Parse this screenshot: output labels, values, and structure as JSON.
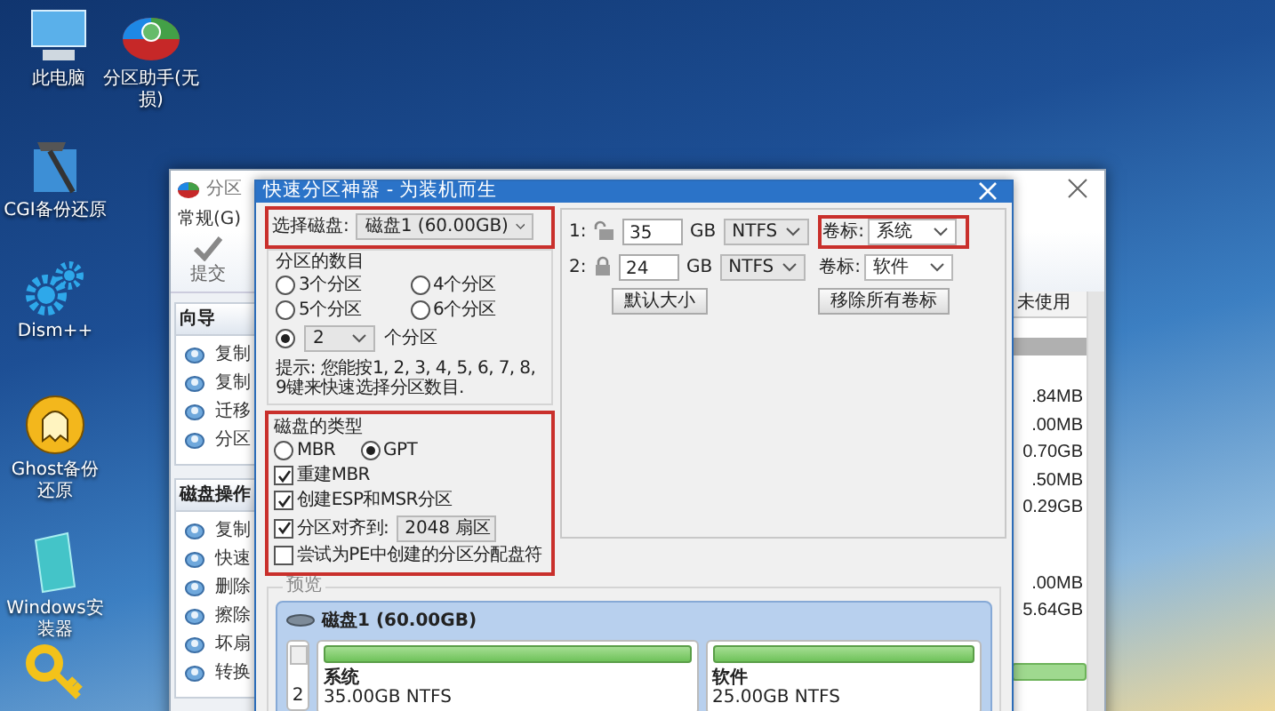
{
  "desktop_icons": [
    {
      "kind": "pc",
      "label": "此电脑"
    },
    {
      "kind": "partition",
      "label": "分区助手(无损)"
    },
    {
      "kind": "cgi",
      "label": "CGI备份还原"
    },
    {
      "kind": "dism",
      "label": "Dism++"
    },
    {
      "kind": "ghost",
      "label": "Ghost备份还原"
    },
    {
      "kind": "installer",
      "label": "Windows安装器"
    },
    {
      "kind": "key"
    }
  ],
  "background_window": {
    "title": "分区",
    "menu": [
      "常规(G)"
    ],
    "toolbar": [
      {
        "label": "提交"
      }
    ],
    "sections": [
      {
        "title": "向导",
        "items": [
          "复制",
          "复制",
          "迁移",
          "分区"
        ]
      },
      {
        "title": "磁盘操作",
        "items": [
          "复制",
          "快速",
          "删除",
          "擦除",
          "坏扇",
          "转换"
        ]
      }
    ],
    "table": {
      "header": "未使用",
      "groups": [
        [
          ".84MB",
          ".00MB",
          "0.70GB",
          ".50MB",
          "0.29GB"
        ],
        [
          ".00MB",
          "5.64GB"
        ]
      ]
    }
  },
  "dialog": {
    "title": "快速分区神器 - 为装机而生",
    "disk_select": {
      "label": "选择磁盘:",
      "value": "磁盘1 (60.00GB)",
      "highlighted": true
    },
    "partition_count": {
      "title": "分区的数目",
      "options": [
        {
          "label": "3个分区",
          "selected": false
        },
        {
          "label": "4个分区",
          "selected": false
        },
        {
          "label": "5个分区",
          "selected": false
        },
        {
          "label": "6个分区",
          "selected": false
        }
      ],
      "custom": {
        "selected": true,
        "value": "2",
        "suffix": "个分区"
      },
      "hint": "提示: 您能按1, 2, 3, 4, 5, 6, 7, 8, 9键来快速选择分区数目."
    },
    "disk_type": {
      "title": "磁盘的类型",
      "highlighted": true,
      "options": [
        {
          "label": "MBR",
          "selected": false
        },
        {
          "label": "GPT",
          "selected": true
        }
      ],
      "checkboxes": [
        {
          "label": "重建MBR",
          "checked": true
        },
        {
          "label": "创建ESP和MSR分区",
          "checked": true
        },
        {
          "label": "分区对齐到:",
          "checked": true,
          "dropdown": "2048 扇区"
        },
        {
          "label": "尝试为PE中创建的分区分配盘符",
          "checked": false
        }
      ]
    },
    "partitions": [
      {
        "index": "1:",
        "locked": false,
        "size": "35",
        "unit": "GB",
        "fs": "NTFS",
        "label_caption": "卷标:",
        "label": "系统",
        "highlighted": true
      },
      {
        "index": "2:",
        "locked": true,
        "size": "24",
        "unit": "GB",
        "fs": "NTFS",
        "label_caption": "卷标:",
        "label": "软件",
        "highlighted": false
      }
    ],
    "buttons": [
      "默认大小",
      "移除所有卷标"
    ],
    "preview": {
      "title": "预览",
      "disk": "磁盘1 (60.00GB)",
      "count": "2",
      "partitions": [
        {
          "name": "系统",
          "detail": "35.00GB NTFS"
        },
        {
          "name": "软件",
          "detail": "25.00GB NTFS"
        }
      ]
    }
  }
}
